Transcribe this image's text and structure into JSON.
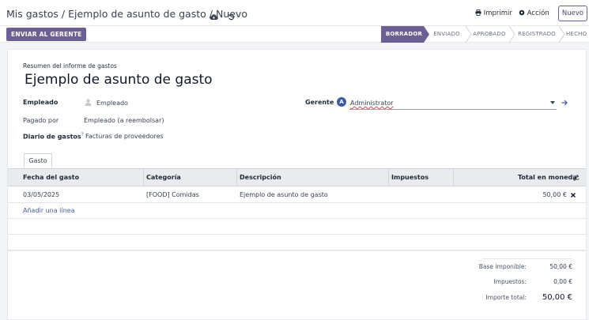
{
  "breadcrumb": {
    "items": [
      "Mis gastos",
      "Ejemplo de asunto de gasto",
      "Nuevo"
    ],
    "separator": "/"
  },
  "header": {
    "print_label": "Imprimir",
    "action_label": "Acción",
    "new_label": "Nuevo"
  },
  "statusbar": {
    "send_label": "ENVIAR AL GERENTE",
    "stages": [
      "BORRADOR",
      "ENVIADO",
      "APROBADO",
      "REGISTRADO",
      "HECHO"
    ],
    "active_stage": "BORRADOR"
  },
  "form": {
    "summary_label": "Resumen del informe de gastos",
    "title": "Ejemplo de asunto de gasto",
    "employee_label": "Empleado",
    "employee_value": "Empleado",
    "paid_by_label": "Pagado por",
    "paid_by_value": "Empleado (a reembolsar)",
    "journal_label": "Diario de gastos",
    "journal_help": "?",
    "journal_value": "Facturas de proveedores",
    "manager_label": "Gerente",
    "manager_avatar": "A",
    "manager_value": "Administrator"
  },
  "tabs": [
    "Gasto"
  ],
  "table": {
    "columns": [
      "Fecha del gasto",
      "Categoría",
      "Descripción",
      "Impuestos",
      "Total en moneda"
    ],
    "rows": [
      {
        "date": "03/05/2025",
        "category": "[FOOD] Comidas",
        "description": "Ejemplo de asunto de gasto",
        "taxes": "",
        "total": "50,00 €"
      }
    ],
    "add_line_label": "Añadir una línea"
  },
  "totals": {
    "base_label": "Base imponible:",
    "base_value": "50,00 €",
    "tax_label": "Impuestos:",
    "tax_value": "0,00 €",
    "total_label": "Importe total:",
    "total_value": "50,00 €"
  },
  "colors": {
    "primary": "#6b5f94",
    "link": "#4b5ba5",
    "avatar": "#3b5ba5"
  }
}
